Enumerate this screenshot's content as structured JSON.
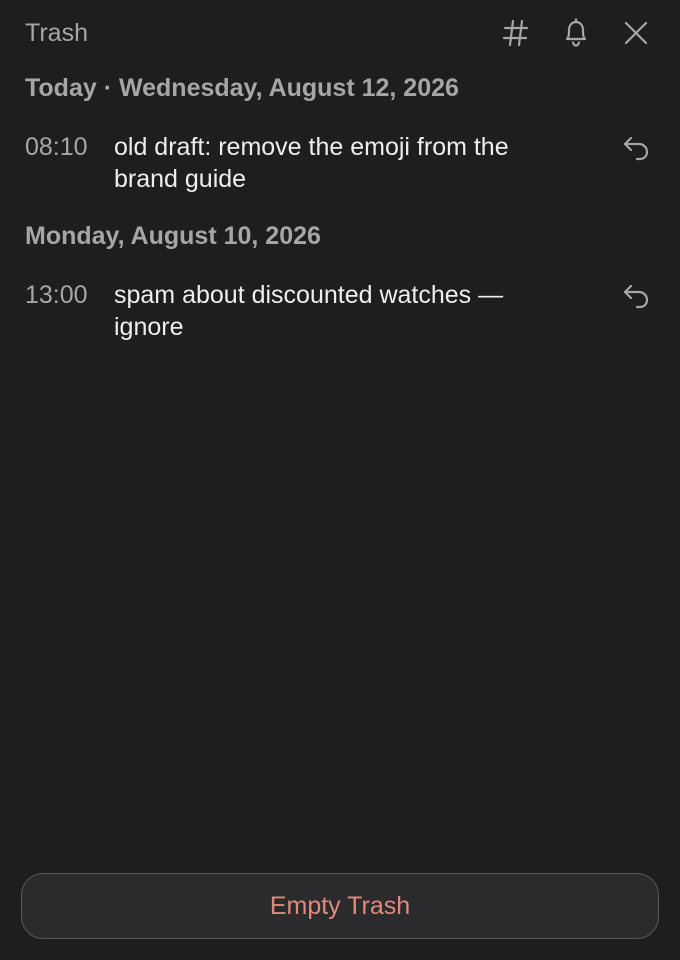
{
  "header": {
    "title": "Trash",
    "icons": [
      "hash-icon",
      "bell-icon",
      "close-icon"
    ]
  },
  "groups": [
    {
      "heading": "Today · Wednesday, August 12, 2026",
      "items": [
        {
          "time": "08:10",
          "text": "old draft: remove the emoji from the brand guide"
        }
      ]
    },
    {
      "heading": "Monday, August 10, 2026",
      "items": [
        {
          "time": "13:00",
          "text": "spam about discounted watches — ignore"
        }
      ]
    }
  ],
  "footer": {
    "empty_label": "Empty Trash"
  },
  "colors": {
    "background": "#1e1e20",
    "muted_text": "#a6a6a8",
    "primary_text": "#eeeeee",
    "danger_text": "#e08a7e",
    "button_bg": "#2b2b2d",
    "button_border": "#5a5a5c"
  }
}
